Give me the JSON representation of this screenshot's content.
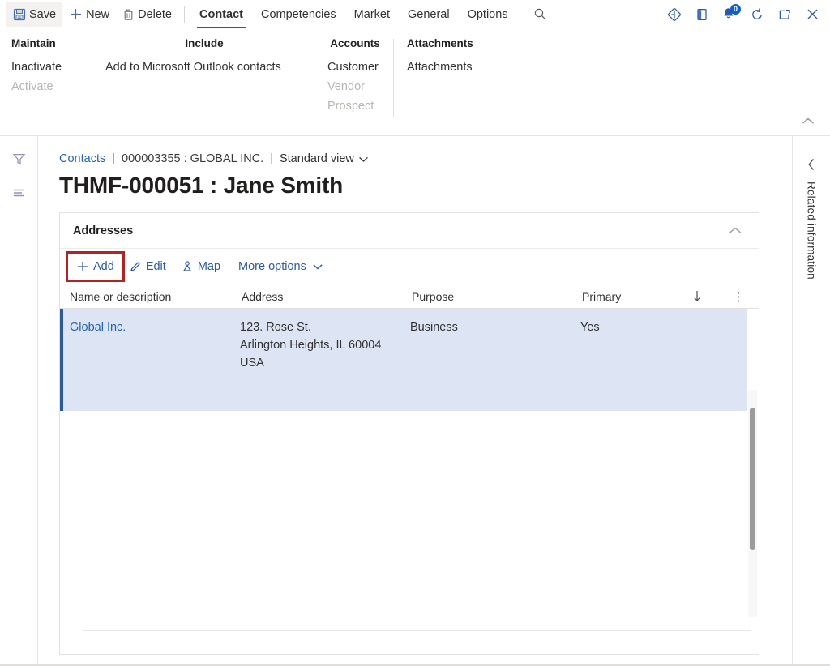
{
  "topbar": {
    "save_label": "Save",
    "new_label": "New",
    "delete_label": "Delete",
    "tabs": [
      {
        "label": "Contact",
        "active": true
      },
      {
        "label": "Competencies",
        "active": false
      },
      {
        "label": "Market",
        "active": false
      },
      {
        "label": "General",
        "active": false
      },
      {
        "label": "Options",
        "active": false
      }
    ],
    "search_icon": "search-icon",
    "right_icons": [
      {
        "name": "diamond-icon",
        "label": ""
      },
      {
        "name": "help-book-icon",
        "label": ""
      },
      {
        "name": "notifications-icon",
        "label": "",
        "badge": "0"
      },
      {
        "name": "refresh-icon",
        "label": ""
      },
      {
        "name": "open-in-new-window-icon",
        "label": ""
      },
      {
        "name": "close-icon",
        "label": ""
      }
    ],
    "accent_color": "#2b579a",
    "badge_color": "#0b5fce"
  },
  "action_pane": {
    "groups": [
      {
        "title": "Maintain",
        "items": [
          {
            "label": "Inactivate",
            "disabled": false
          },
          {
            "label": "Activate",
            "disabled": true
          }
        ]
      },
      {
        "title": "Include",
        "items": [
          {
            "label": "Add to Microsoft Outlook contacts",
            "disabled": false
          }
        ]
      },
      {
        "title": "Accounts",
        "items": [
          {
            "label": "Customer",
            "disabled": false
          },
          {
            "label": "Vendor",
            "disabled": true
          },
          {
            "label": "Prospect",
            "disabled": true
          }
        ]
      },
      {
        "title": "Attachments",
        "items": [
          {
            "label": "Attachments",
            "disabled": false
          }
        ]
      }
    ],
    "collapse_icon": "chevron-up-icon"
  },
  "left_rail": {
    "icons": [
      {
        "name": "filter-icon"
      },
      {
        "name": "list-lines-icon"
      }
    ]
  },
  "right_rail": {
    "chevron_icon": "chevron-left-icon",
    "label": "Related information"
  },
  "breadcrumb": {
    "root": "Contacts",
    "separator": "|",
    "record": "000003355 : GLOBAL INC.",
    "view": "Standard view"
  },
  "page": {
    "title": "THMF-000051 : Jane Smith"
  },
  "addresses_card": {
    "title": "Addresses",
    "collapse_icon": "chevron-up-icon",
    "toolbar": [
      {
        "label": "Add",
        "icon": "plus-icon",
        "highlighted": true
      },
      {
        "label": "Edit",
        "icon": "pencil-icon",
        "highlighted": false
      },
      {
        "label": "Map",
        "icon": "map-pin-icon",
        "highlighted": false
      },
      {
        "label": "More options",
        "icon": "chevron-down-icon",
        "highlighted": false
      }
    ],
    "highlight_color": "#b52222",
    "columns": [
      "Name or description",
      "Address",
      "Purpose",
      "Primary"
    ],
    "sort_icon": "sort-descending-arrow-icon",
    "column_menu_icon": "vertical-ellipsis-icon",
    "rows": [
      {
        "name": "Global Inc.",
        "address_lines": [
          "123. Rose St.",
          "Arlington Heights, IL 60004",
          "USA"
        ],
        "purpose": "Business",
        "primary": "Yes",
        "selected": true
      }
    ],
    "selection_color": "#dde5f5",
    "selection_bar_color": "#2b5aa0"
  }
}
